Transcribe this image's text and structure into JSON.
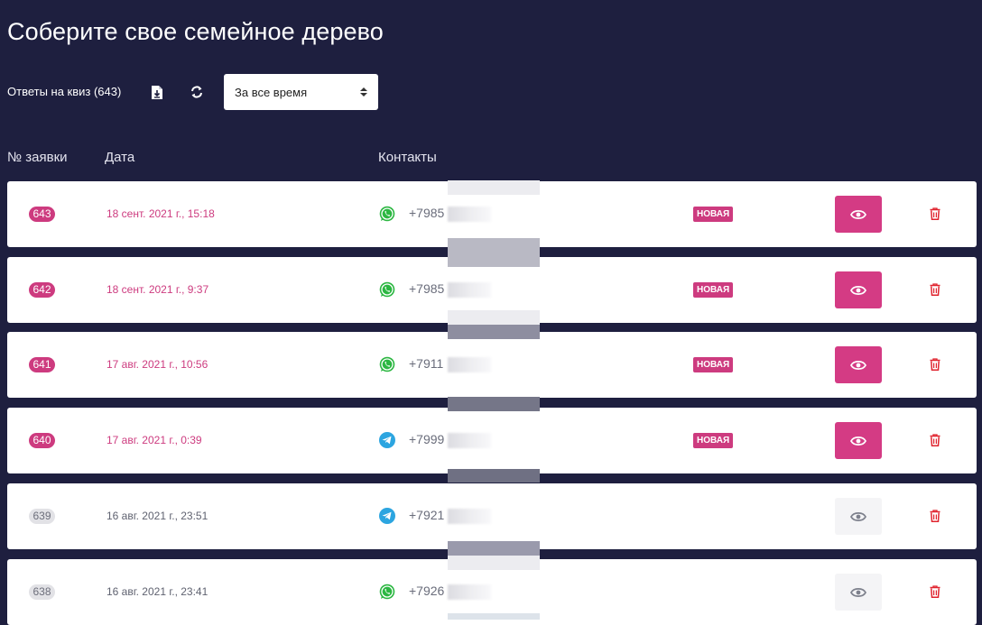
{
  "page": {
    "title": "Соберите свое семейное дерево"
  },
  "toolbar": {
    "count_label": "Ответы на квиз (643)",
    "download_icon": "file-download-icon",
    "refresh_icon": "refresh-icon",
    "period_select": "За все время"
  },
  "table": {
    "headers": {
      "number": "№ заявки",
      "date": "Дата",
      "contacts": "Контакты"
    },
    "rows": [
      {
        "number": "643",
        "date": "18 сент. 2021 г., 15:18",
        "messenger": "whatsapp",
        "phone": "+7985",
        "status": "НОВАЯ",
        "is_new": true
      },
      {
        "number": "642",
        "date": "18 сент. 2021 г., 9:37",
        "messenger": "whatsapp",
        "phone": "+7985",
        "status": "НОВАЯ",
        "is_new": true
      },
      {
        "number": "641",
        "date": "17 авг. 2021 г., 10:56",
        "messenger": "whatsapp",
        "phone": "+7911",
        "status": "НОВАЯ",
        "is_new": true
      },
      {
        "number": "640",
        "date": "17 авг. 2021 г., 0:39",
        "messenger": "telegram",
        "phone": "+7999",
        "status": "НОВАЯ",
        "is_new": true
      },
      {
        "number": "639",
        "date": "16 авг. 2021 г., 23:51",
        "messenger": "telegram",
        "phone": "+7921",
        "status": "",
        "is_new": false
      },
      {
        "number": "638",
        "date": "16 авг. 2021 г., 23:41",
        "messenger": "whatsapp",
        "phone": "+7926",
        "status": "",
        "is_new": false
      }
    ]
  },
  "colors": {
    "background": "#1e1f3f",
    "accent": "#cd3b7f",
    "whatsapp": "#2cb742",
    "telegram": "#2ca5e0",
    "delete": "#e0242f"
  }
}
